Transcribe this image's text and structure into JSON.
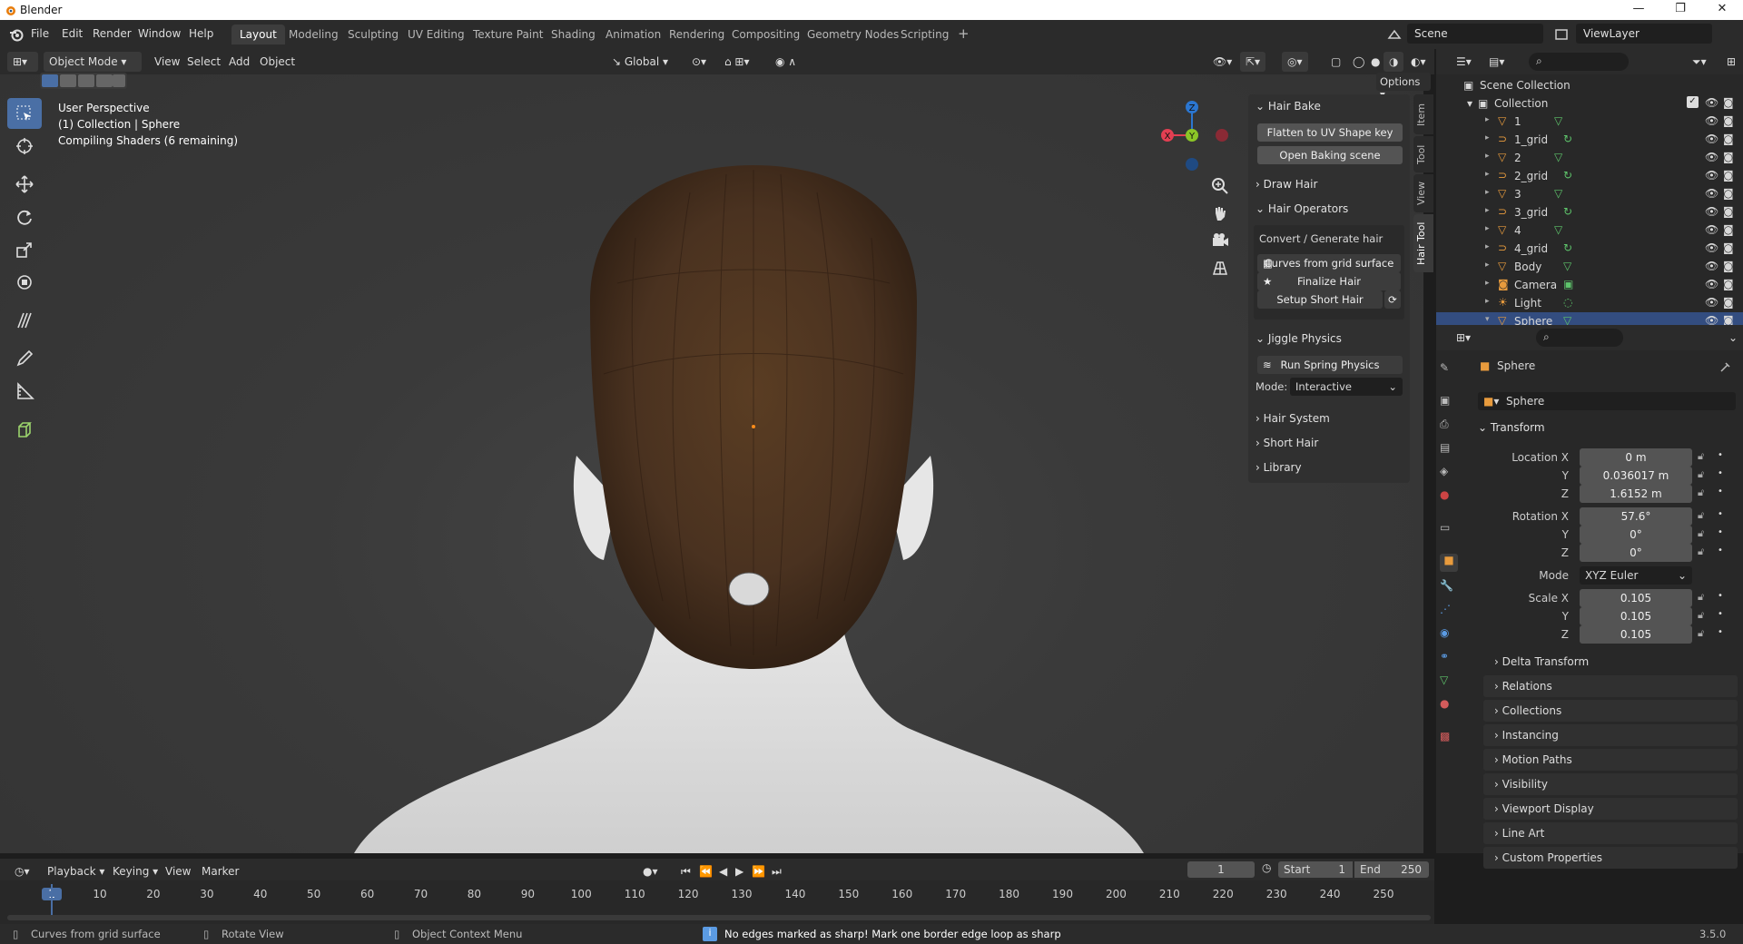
{
  "window": {
    "title": "Blender"
  },
  "menu": [
    "File",
    "Edit",
    "Render",
    "Window",
    "Help"
  ],
  "workspaces": [
    "Layout",
    "Modeling",
    "Sculpting",
    "UV Editing",
    "Texture Paint",
    "Shading",
    "Animation",
    "Rendering",
    "Compositing",
    "Geometry Nodes",
    "Scripting"
  ],
  "active_workspace": "Layout",
  "scene": {
    "name": "Scene",
    "view_layer": "ViewLayer"
  },
  "viewport_header": {
    "mode": "Object Mode",
    "menus": [
      "View",
      "Select",
      "Add",
      "Object"
    ],
    "orientation": "Global",
    "options": "Options"
  },
  "viewport_info": {
    "line1": "User Perspective",
    "line2": "(1) Collection | Sphere",
    "line3": "Compiling Shaders (6 remaining)"
  },
  "gizmo": {
    "x": "X",
    "y": "Y",
    "z": "Z"
  },
  "npanel": {
    "hair_bake": "Hair Bake",
    "flatten": "Flatten to UV Shape key",
    "open_baking": "Open Baking scene",
    "draw_hair": "Draw Hair",
    "hair_operators": "Hair Operators",
    "convert_generate": "Convert / Generate hair",
    "curves_from_grid": "Curves from grid surface",
    "finalize_hair": "Finalize Hair",
    "setup_short_hair": "Setup Short Hair",
    "jiggle_physics": "Jiggle Physics",
    "run_spring": "Run Spring Physics",
    "mode_label": "Mode:",
    "mode_value": "Interactive",
    "hair_system": "Hair System",
    "short_hair": "Short Hair",
    "library": "Library"
  },
  "side_tabs": [
    "Item",
    "Tool",
    "View",
    "Hair Tool"
  ],
  "outliner": {
    "scene_collection": "Scene Collection",
    "collection": "Collection",
    "items": [
      {
        "name": "1",
        "type": "mesh"
      },
      {
        "name": "1_grid",
        "type": "curve"
      },
      {
        "name": "2",
        "type": "mesh"
      },
      {
        "name": "2_grid",
        "type": "curve"
      },
      {
        "name": "3",
        "type": "mesh"
      },
      {
        "name": "3_grid",
        "type": "curve"
      },
      {
        "name": "4",
        "type": "mesh"
      },
      {
        "name": "4_grid",
        "type": "curve"
      },
      {
        "name": "Body",
        "type": "mesh"
      },
      {
        "name": "Camera",
        "type": "camera"
      },
      {
        "name": "Light",
        "type": "light"
      },
      {
        "name": "Sphere",
        "type": "mesh"
      }
    ],
    "selected": "Sphere"
  },
  "properties": {
    "object_name": "Sphere",
    "datablock": "Sphere",
    "transform": "Transform",
    "location": {
      "label": "Location X",
      "x": "0 m",
      "y": "0.036017 m",
      "z": "1.6152 m"
    },
    "rotation": {
      "label": "Rotation X",
      "x": "57.6°",
      "y": "0°",
      "z": "0°"
    },
    "mode_label": "Mode",
    "mode_value": "XYZ Euler",
    "scale": {
      "label": "Scale X",
      "x": "0.105",
      "y": "0.105",
      "z": "0.105"
    },
    "axis_y": "Y",
    "axis_z": "Z",
    "delta": "Delta Transform",
    "sections": [
      "Relations",
      "Collections",
      "Instancing",
      "Motion Paths",
      "Visibility",
      "Viewport Display",
      "Line Art",
      "Custom Properties"
    ]
  },
  "timeline": {
    "menus": [
      "Playback",
      "Keying",
      "View",
      "Marker"
    ],
    "current_frame": "1",
    "start_label": "Start",
    "start": "1",
    "end_label": "End",
    "end": "250",
    "ticks": [
      "1",
      "10",
      "20",
      "30",
      "40",
      "50",
      "60",
      "70",
      "80",
      "90",
      "100",
      "110",
      "120",
      "130",
      "140",
      "150",
      "160",
      "170",
      "180",
      "190",
      "200",
      "210",
      "220",
      "230",
      "240",
      "250"
    ]
  },
  "statusbar": {
    "left": "Curves from grid surface",
    "middle": "Rotate View",
    "context": "Object Context Menu",
    "message": "No edges marked as sharp! Mark one border edge loop as sharp",
    "version": "3.5.0"
  },
  "colors": {
    "accent": "#4a6fa5",
    "selection": "#334d80",
    "x_axis": "#e33f52",
    "y_axis": "#8bc527",
    "z_axis": "#2b76d0",
    "hair": "#4a3220"
  }
}
